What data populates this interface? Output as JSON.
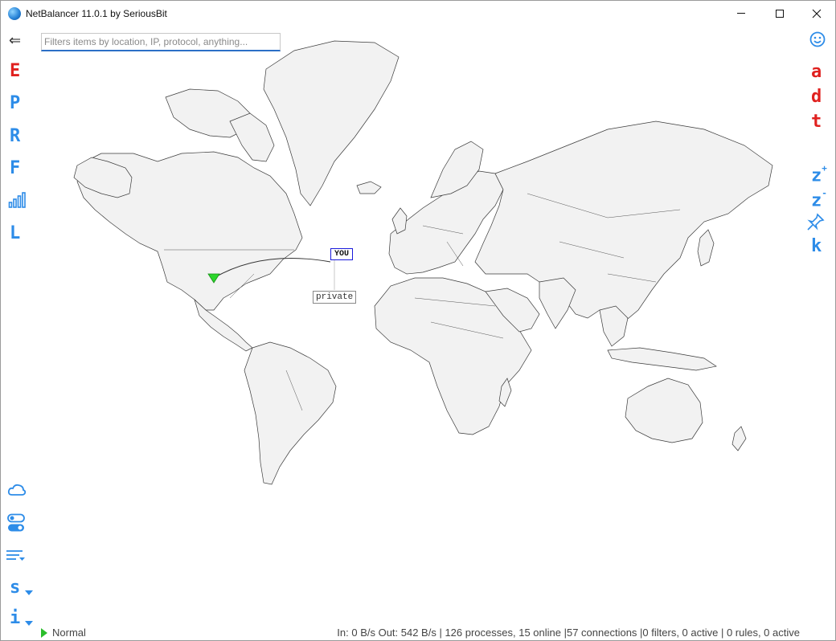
{
  "window": {
    "title": "NetBalancer 11.0.1 by SeriousBit"
  },
  "filter": {
    "placeholder": "Filters items by location, IP, protocol, anything...",
    "value": ""
  },
  "left_sidebar": {
    "back_glyph": "⇐",
    "letters": [
      {
        "label": "E",
        "color": "#e0211f"
      },
      {
        "label": "P",
        "color": "#2d8ce8"
      },
      {
        "label": "R",
        "color": "#2d8ce8"
      },
      {
        "label": "F",
        "color": "#2d8ce8"
      },
      {
        "label": "L",
        "color": "#2d8ce8"
      }
    ],
    "bottom_letters": [
      {
        "label": "s",
        "color": "#2d8ce8"
      },
      {
        "label": "i",
        "color": "#2d8ce8"
      }
    ],
    "icons": [
      "bar-chart-icon",
      "cloud-icon",
      "toggles-icon",
      "menu-lines-icon",
      "chevron-down-icon"
    ]
  },
  "right_sidebar": {
    "letters": [
      {
        "label": "a",
        "color": "#e0211f"
      },
      {
        "label": "d",
        "color": "#e0211f"
      },
      {
        "label": "t",
        "color": "#e0211f"
      }
    ],
    "zoom_in": "z",
    "zoom_in_sup": "+",
    "zoom_out": "z",
    "zoom_out_sup": "-",
    "k": "k",
    "icons": [
      "smiley-icon",
      "pin-icon"
    ]
  },
  "map": {
    "you_label": "YOU",
    "private_label": "private",
    "marker_color": "#2bd62b"
  },
  "status": {
    "mode": "Normal",
    "stats": "In: 0 B/s  Out: 542 B/s  |  126 processes, 15 online  |57 connections  |0 filters, 0 active  |  0 rules, 0 active"
  },
  "colors": {
    "accent_blue": "#2d8ce8",
    "accent_red": "#e0211f",
    "input_underline": "#2b6fc6"
  }
}
